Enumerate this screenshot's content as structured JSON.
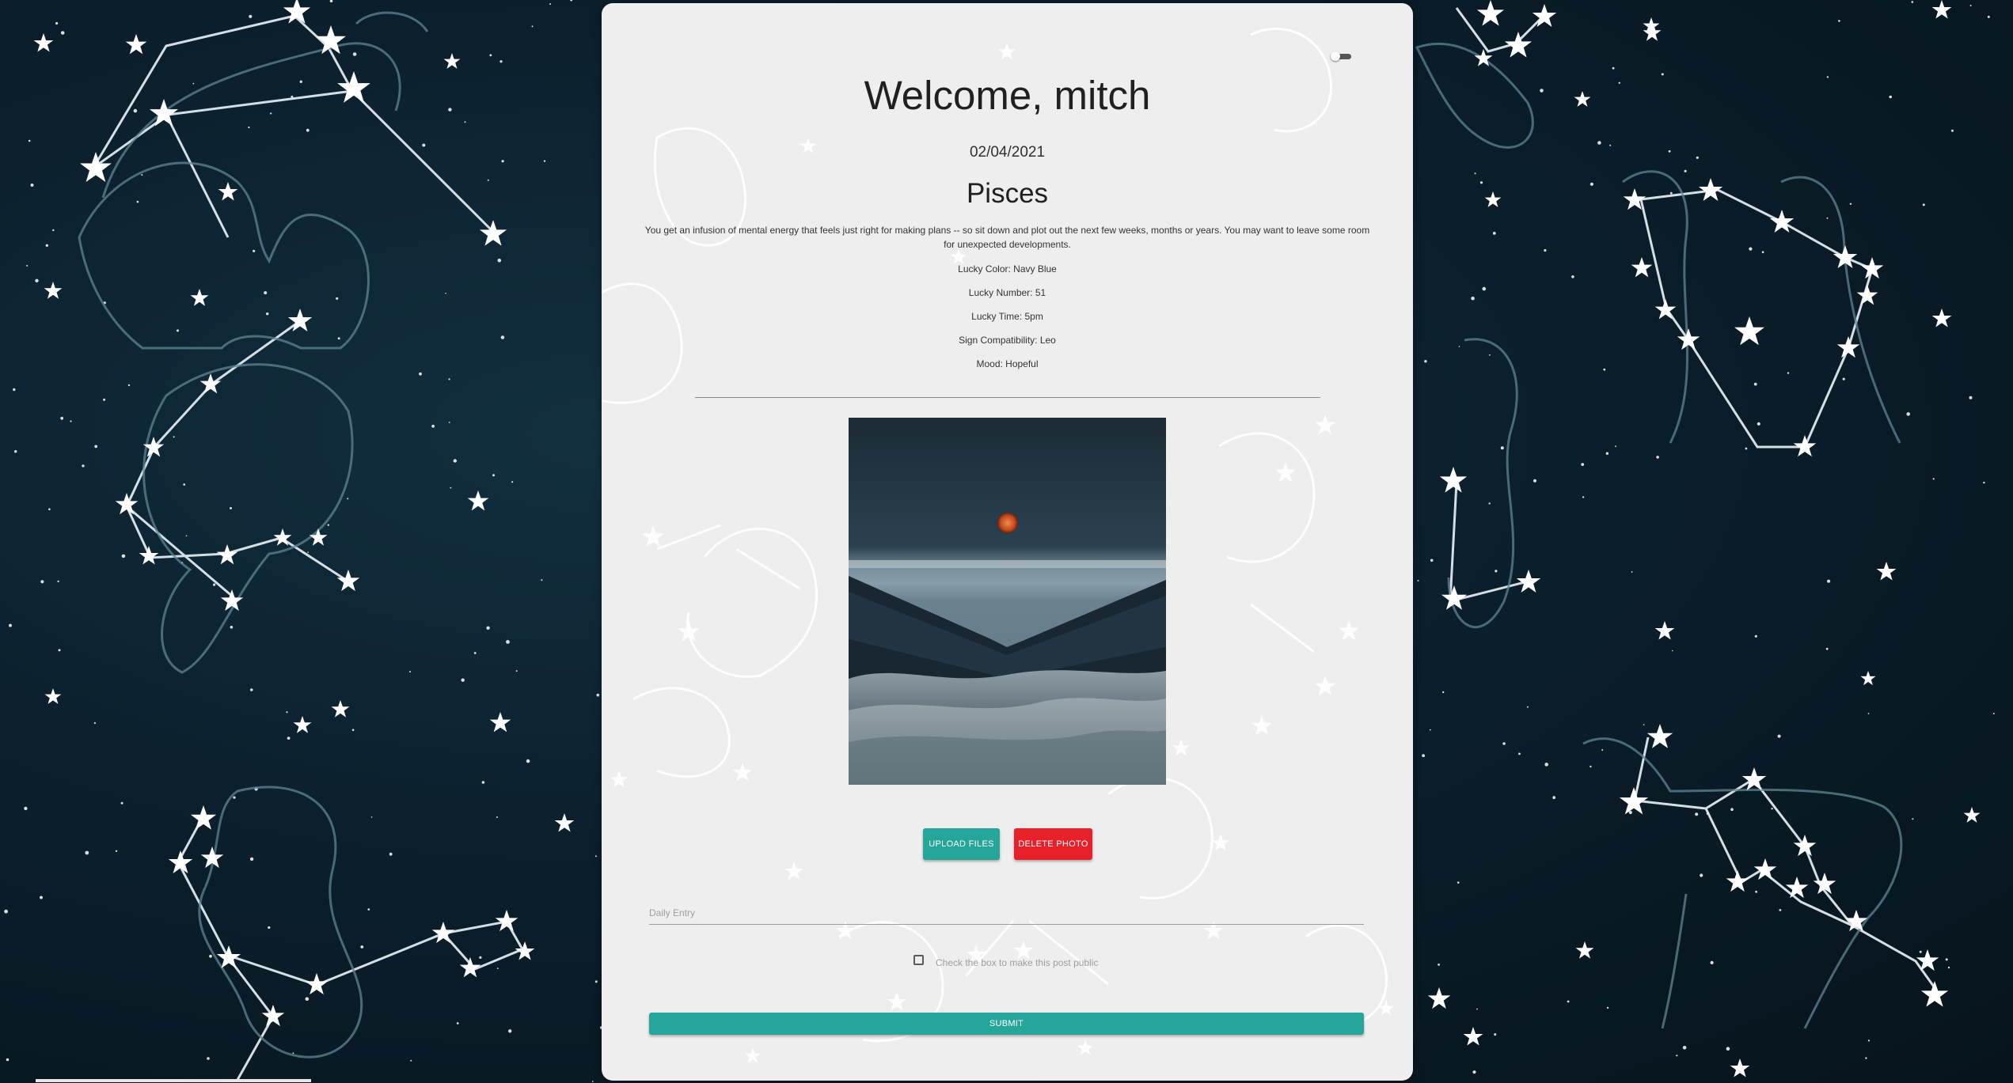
{
  "header": {
    "welcome": "Welcome, mitch",
    "date": "02/04/2021"
  },
  "horoscope": {
    "sign": "Pisces",
    "description": "You get an infusion of mental energy that feels just right for making plans -- so sit down and plot out the next few weeks, months or years. You may want to leave some room for unexpected developments.",
    "lucky_color": "Lucky Color: Navy Blue",
    "lucky_number": "Lucky Number: 51",
    "lucky_time": "Lucky Time: 5pm",
    "compatibility": "Sign Compatibility: Leo",
    "mood": "Mood: Hopeful"
  },
  "actions": {
    "upload_label": "UPLOAD FILES",
    "delete_label": "DELETE PHOTO",
    "submit_label": "SUBMIT"
  },
  "entry": {
    "placeholder": "Daily Entry",
    "public_label": "Check the box to make this post public",
    "public_checked": false
  },
  "theme": {
    "accent": "#26a69a",
    "danger": "#e8202a",
    "card_bg": "#eeeeee",
    "sky_bg": "#0b1f2c"
  },
  "icons": {
    "toggle": "dark-mode-toggle-icon",
    "checkbox": "checkbox-icon"
  }
}
